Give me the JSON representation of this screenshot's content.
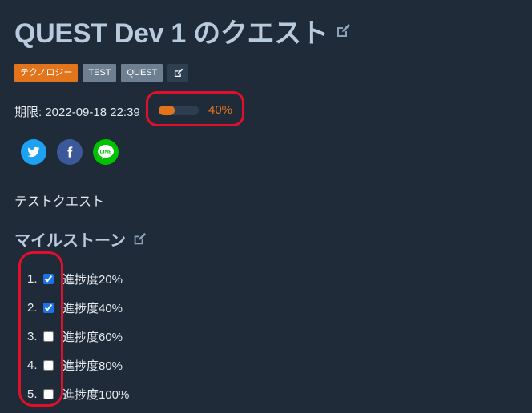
{
  "quest": {
    "title": "QUEST Dev 1 のクエスト",
    "tags": [
      "テクノロジー",
      "TEST",
      "QUEST"
    ],
    "deadline": "期限: 2022-09-18 22:39",
    "progress": {
      "percent": 40,
      "label": "40%"
    },
    "description": "テストクエスト"
  },
  "share": {
    "icons": [
      "twitter-icon",
      "facebook-icon",
      "line-icon"
    ],
    "line_label": "LINE"
  },
  "milestones": {
    "title": "マイルストーン",
    "items": [
      {
        "num": "1.",
        "label": "進捗度20%",
        "checked": true
      },
      {
        "num": "2.",
        "label": "進捗度40%",
        "checked": true
      },
      {
        "num": "3.",
        "label": "進捗度60%",
        "checked": false
      },
      {
        "num": "4.",
        "label": "進捗度80%",
        "checked": false
      },
      {
        "num": "5.",
        "label": "進捗度100%",
        "checked": false
      }
    ]
  },
  "colors": {
    "accent": "#e2741c",
    "background": "#1f2b38",
    "annotation": "#e0102a"
  }
}
